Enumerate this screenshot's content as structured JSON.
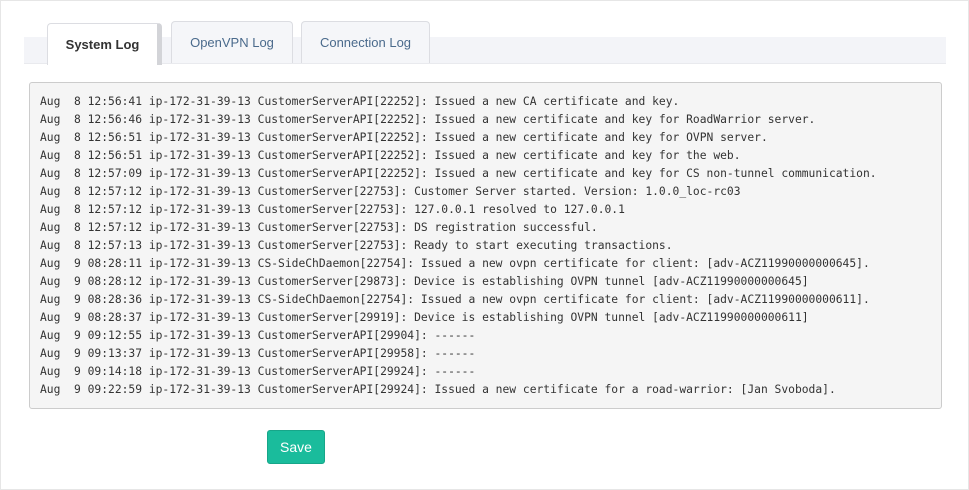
{
  "tabs": [
    {
      "label": "System Log",
      "active": true
    },
    {
      "label": "OpenVPN Log",
      "active": false
    },
    {
      "label": "Connection Log",
      "active": false
    }
  ],
  "log_lines": [
    "Aug  8 12:56:41 ip-172-31-39-13 CustomerServerAPI[22252]: Issued a new CA certificate and key.",
    "Aug  8 12:56:46 ip-172-31-39-13 CustomerServerAPI[22252]: Issued a new certificate and key for RoadWarrior server.",
    "Aug  8 12:56:51 ip-172-31-39-13 CustomerServerAPI[22252]: Issued a new certificate and key for OVPN server.",
    "Aug  8 12:56:51 ip-172-31-39-13 CustomerServerAPI[22252]: Issued a new certificate and key for the web.",
    "Aug  8 12:57:09 ip-172-31-39-13 CustomerServerAPI[22252]: Issued a new certificate and key for CS non-tunnel communication.",
    "Aug  8 12:57:12 ip-172-31-39-13 CustomerServer[22753]: Customer Server started. Version: 1.0.0_loc-rc03",
    "Aug  8 12:57:12 ip-172-31-39-13 CustomerServer[22753]: 127.0.0.1 resolved to 127.0.0.1",
    "Aug  8 12:57:12 ip-172-31-39-13 CustomerServer[22753]: DS registration successful.",
    "Aug  8 12:57:13 ip-172-31-39-13 CustomerServer[22753]: Ready to start executing transactions.",
    "Aug  9 08:28:11 ip-172-31-39-13 CS-SideChDaemon[22754]: Issued a new ovpn certificate for client: [adv-ACZ11990000000645].",
    "Aug  9 08:28:12 ip-172-31-39-13 CustomerServer[29873]: Device is establishing OVPN tunnel [adv-ACZ11990000000645]",
    "Aug  9 08:28:36 ip-172-31-39-13 CS-SideChDaemon[22754]: Issued a new ovpn certificate for client: [adv-ACZ11990000000611].",
    "Aug  9 08:28:37 ip-172-31-39-13 CustomerServer[29919]: Device is establishing OVPN tunnel [adv-ACZ11990000000611]",
    "Aug  9 09:12:55 ip-172-31-39-13 CustomerServerAPI[29904]: ------",
    "Aug  9 09:13:37 ip-172-31-39-13 CustomerServerAPI[29958]: ------",
    "Aug  9 09:14:18 ip-172-31-39-13 CustomerServerAPI[29924]: ------",
    "Aug  9 09:22:59 ip-172-31-39-13 CustomerServerAPI[29924]: Issued a new certificate for a road-warrior: [Jan Svoboda]."
  ],
  "save_label": "Save",
  "colors": {
    "accent": "#1abc9c",
    "tab_link": "#4a6a8c",
    "log_background": "#f5f5f5"
  }
}
